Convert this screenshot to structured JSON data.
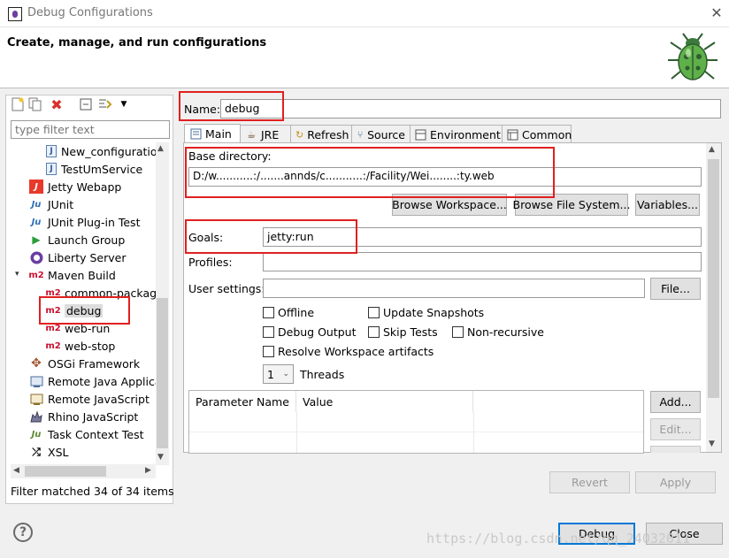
{
  "window": {
    "title": "Debug Configurations",
    "close_glyph": "✕",
    "icon": "debug-app-icon"
  },
  "header": {
    "title": "Create, manage, and run configurations",
    "logo": "bug-icon"
  },
  "left_panel": {
    "filter_placeholder": "type filter text",
    "tree": [
      {
        "label": "New_configuratio",
        "icon": "java-app-icon"
      },
      {
        "label": "TestUmService",
        "icon": "java-app-icon"
      },
      {
        "label": "Jetty Webapp",
        "icon": "jetty-icon"
      },
      {
        "label": "JUnit",
        "icon": "junit-icon"
      },
      {
        "label": "JUnit Plug-in Test",
        "icon": "junit-plugin-icon"
      },
      {
        "label": "Launch Group",
        "icon": "launch-group-icon"
      },
      {
        "label": "Liberty Server",
        "icon": "liberty-icon"
      },
      {
        "label": "Maven Build",
        "icon": "m2-icon"
      },
      {
        "label": "common-package",
        "icon": "m2-icon"
      },
      {
        "label": "debug",
        "icon": "m2-icon"
      },
      {
        "label": "web-run",
        "icon": "m2-icon"
      },
      {
        "label": "web-stop",
        "icon": "m2-icon"
      },
      {
        "label": "OSGi Framework",
        "icon": "osgi-icon"
      },
      {
        "label": "Remote Java Applica",
        "icon": "remote-java-icon"
      },
      {
        "label": "Remote JavaScript",
        "icon": "remote-js-icon"
      },
      {
        "label": "Rhino JavaScript",
        "icon": "rhino-icon"
      },
      {
        "label": "Task Context Test",
        "icon": "task-junit-icon"
      },
      {
        "label": "XSL",
        "icon": "xsl-icon"
      }
    ],
    "m2_text": "m2",
    "ju_text": "Ju",
    "filter_status": "Filter matched 34 of 34 items"
  },
  "config": {
    "name_label": "Name:",
    "name_value": "debug",
    "tabs": [
      {
        "label": "Main",
        "icon": "main-tab-icon"
      },
      {
        "label": "JRE",
        "icon": "jre-icon"
      },
      {
        "label": "Refresh",
        "icon": "refresh-icon"
      },
      {
        "label": "Source",
        "icon": "source-icon"
      },
      {
        "label": "Environment",
        "icon": "environment-icon"
      },
      {
        "label": "Common",
        "icon": "common-icon"
      }
    ],
    "base_dir_label": "Base directory:",
    "base_dir_value": "D:/w...........:/.......annds/c...........:/Facility/Wei........:ty.web",
    "browse_workspace": "Browse Workspace...",
    "browse_fs": "Browse File System...",
    "variables": "Variables...",
    "goals_label": "Goals:",
    "goals_value": "jetty:run",
    "profiles_label": "Profiles:",
    "profiles_value": "",
    "user_settings_label": "User settings:",
    "user_settings_value": "",
    "file_button": "File...",
    "checkboxes": {
      "offline": "Offline",
      "update_snapshots": "Update Snapshots",
      "debug_output": "Debug Output",
      "skip_tests": "Skip Tests",
      "non_recursive": "Non-recursive",
      "resolve_workspace": "Resolve Workspace artifacts"
    },
    "threads_value": "1",
    "threads_label": "Threads",
    "param_headers": [
      "Parameter Name",
      "Value"
    ],
    "add_button": "Add...",
    "edit_button": "Edit...",
    "revert_button": "Revert",
    "apply_button": "Apply"
  },
  "footer": {
    "help_glyph": "?",
    "debug_button": "Debug",
    "close_button": "Close",
    "watermark": "https://blog.csdn.net/qq_24032011"
  },
  "accent_colors": {
    "annotation": "#e02020",
    "maven": "#c8102e",
    "focus": "#0078d7"
  }
}
